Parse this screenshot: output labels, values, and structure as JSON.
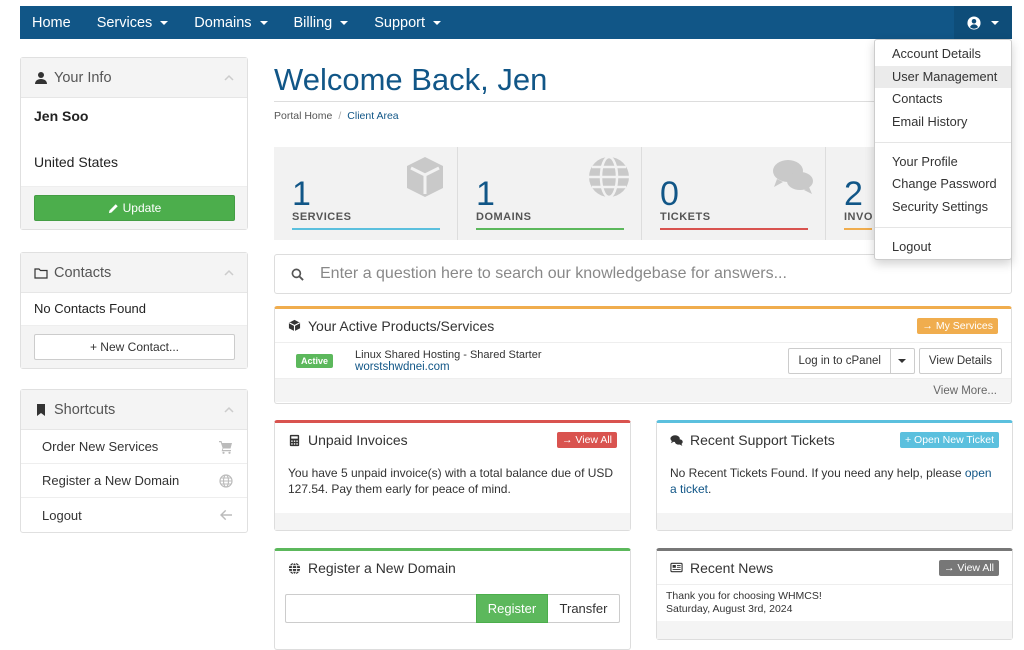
{
  "nav": {
    "items": [
      {
        "label": "Home",
        "caret": false
      },
      {
        "label": "Services",
        "caret": true
      },
      {
        "label": "Domains",
        "caret": true
      },
      {
        "label": "Billing",
        "caret": true
      },
      {
        "label": "Support",
        "caret": true
      }
    ],
    "user_icon": "user-circle-icon"
  },
  "account_menu": {
    "group1": [
      "Account Details",
      "User Management",
      "Contacts",
      "Email History"
    ],
    "group2": [
      "Your Profile",
      "Change Password",
      "Security Settings"
    ],
    "group3": [
      "Logout"
    ],
    "highlighted": "User Management"
  },
  "sidebar": {
    "your_info": {
      "title": "Your Info",
      "name": "Jen Soo",
      "country": "United States",
      "update_label": "Update"
    },
    "contacts": {
      "title": "Contacts",
      "empty": "No Contacts Found",
      "new_label": "+ New Contact..."
    },
    "shortcuts": {
      "title": "Shortcuts",
      "items": [
        {
          "label": "Order New Services",
          "icon": "cart-icon"
        },
        {
          "label": "Register a New Domain",
          "icon": "globe-icon"
        },
        {
          "label": "Logout",
          "icon": "arrow-left-icon"
        }
      ]
    }
  },
  "main": {
    "welcome": "Welcome Back, Jen",
    "breadcrumb": {
      "home": "Portal Home",
      "current": "Client Area"
    },
    "tiles": [
      {
        "count": "1",
        "label": "SERVICES",
        "color": "#5bc0de",
        "icon": "cube-icon"
      },
      {
        "count": "1",
        "label": "DOMAINS",
        "color": "#5cb85c",
        "icon": "globe-icon"
      },
      {
        "count": "0",
        "label": "TICKETS",
        "color": "#d9534f",
        "icon": "comments-icon"
      },
      {
        "count": "2",
        "label": "INVO",
        "color": "#f0ad4e",
        "icon": "credit-card-icon"
      }
    ],
    "kb_placeholder": "Enter a question here to search our knowledgebase for answers...",
    "active_products": {
      "title": "Your Active Products/Services",
      "badge": "→ My Services",
      "status": "Active",
      "product": "Linux Shared Hosting - Shared Starter",
      "domain": "worstshwdnei.com",
      "login_label": "Log in to cPanel",
      "details_label": "View Details",
      "view_more": "View More..."
    },
    "unpaid_invoices": {
      "title": "Unpaid Invoices",
      "badge": "→ View All",
      "text": "You have 5 unpaid invoice(s) with a total balance due of USD 127.54. Pay them early for peace of mind."
    },
    "support_tickets": {
      "title": "Recent Support Tickets",
      "badge": "+ Open New Ticket",
      "text_before": "No Recent Tickets Found. If you need any help, please",
      "link": "open a ticket",
      "text_after": "."
    },
    "register_domain": {
      "title": "Register a New Domain",
      "register_label": "Register",
      "transfer_label": "Transfer"
    },
    "news": {
      "title": "Recent News",
      "badge": "→ View All",
      "headline": "Thank you for choosing WHMCS!",
      "date": "Saturday, August 3rd, 2024"
    }
  },
  "colors": {
    "brand": "#115687",
    "success": "#5cb85c",
    "danger": "#d9534f",
    "info": "#5bc0de",
    "warning": "#f0ad4e",
    "grey": "#777777"
  }
}
